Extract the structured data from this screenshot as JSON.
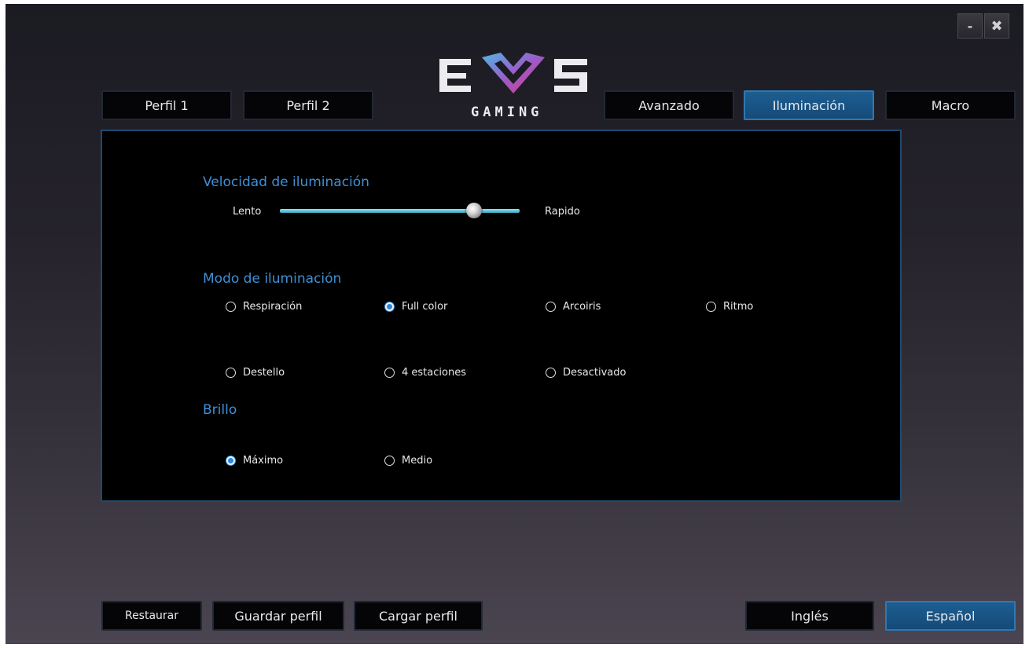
{
  "window": {
    "minimize_label": "-",
    "close_label": "✖"
  },
  "logo": {
    "main": "EVS",
    "sub": "GAMING"
  },
  "tabs": [
    {
      "label": "Perfil 1",
      "active": false
    },
    {
      "label": "Perfil 2",
      "active": false
    },
    {
      "label": "Avanzado",
      "active": false
    },
    {
      "label": "Iluminación",
      "active": true
    },
    {
      "label": "Macro",
      "active": false
    }
  ],
  "speed": {
    "title": "Velocidad de iluminación",
    "min_label": "Lento",
    "max_label": "Rapido",
    "value_fraction": 0.81
  },
  "mode": {
    "title": "Modo de iluminación",
    "options": [
      {
        "label": "Respiración",
        "checked": false
      },
      {
        "label": "Full color",
        "checked": true
      },
      {
        "label": "Arcoiris",
        "checked": false
      },
      {
        "label": "Ritmo",
        "checked": false
      },
      {
        "label": "Destello",
        "checked": false
      },
      {
        "label": "4 estaciones",
        "checked": false
      },
      {
        "label": "Desactivado",
        "checked": false
      }
    ]
  },
  "brightness": {
    "title": "Brillo",
    "options": [
      {
        "label": "Máximo",
        "checked": true
      },
      {
        "label": "Medio",
        "checked": false
      }
    ]
  },
  "footer": {
    "restore_label": "Restaurar",
    "save_label": "Guardar perfil",
    "load_label": "Cargar perfil",
    "english_label": "Inglés",
    "spanish_label": "Español"
  },
  "colors": {
    "accent": "#1d5e92",
    "section_title": "#3f8fd6",
    "slider": "#5cc3d8",
    "logo_v": "#e0348a"
  }
}
